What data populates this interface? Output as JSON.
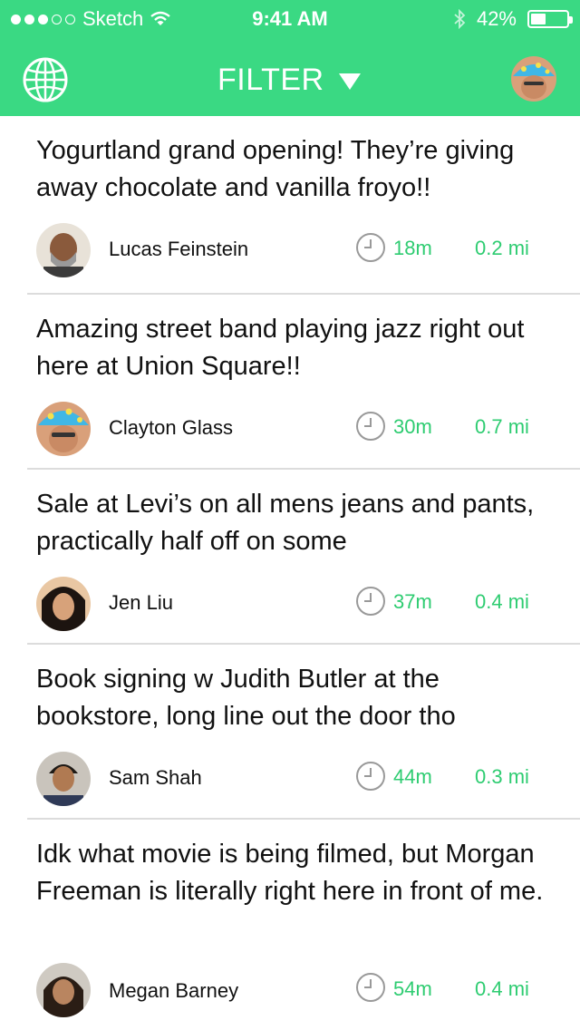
{
  "status_bar": {
    "carrier": "Sketch",
    "time": "9:41 AM",
    "battery": "42%",
    "battery_level": 0.42
  },
  "nav": {
    "title": "FILTER",
    "left_icon": "globe-icon",
    "right_icon": "profile-avatar"
  },
  "colors": {
    "brand_green": "#3ad983",
    "accent_green": "#2ecc71",
    "divider": "#dcdcdc"
  },
  "posts": [
    {
      "text": "Yogurtland grand opening! They’re giving away chocolate and vanilla froyo!!",
      "author": "Lucas Feinstein",
      "time": "18m",
      "distance": "0.2 mi"
    },
    {
      "text": "Amazing street band playing jazz right out here at Union Square!!",
      "author": "Clayton Glass",
      "time": "30m",
      "distance": "0.7 mi"
    },
    {
      "text": "Sale at Levi’s on all mens jeans and pants, practically half off on some",
      "author": "Jen Liu",
      "time": "37m",
      "distance": "0.4 mi"
    },
    {
      "text": "Book signing w Judith Butler at the bookstore, long line out the door tho",
      "author": "Sam Shah",
      "time": "44m",
      "distance": "0.3 mi"
    },
    {
      "text": "Idk what movie is being filmed, but Morgan Freeman is literally right here in front of me.",
      "author": "Megan Barney",
      "time": "54m",
      "distance": "0.4 mi"
    }
  ]
}
